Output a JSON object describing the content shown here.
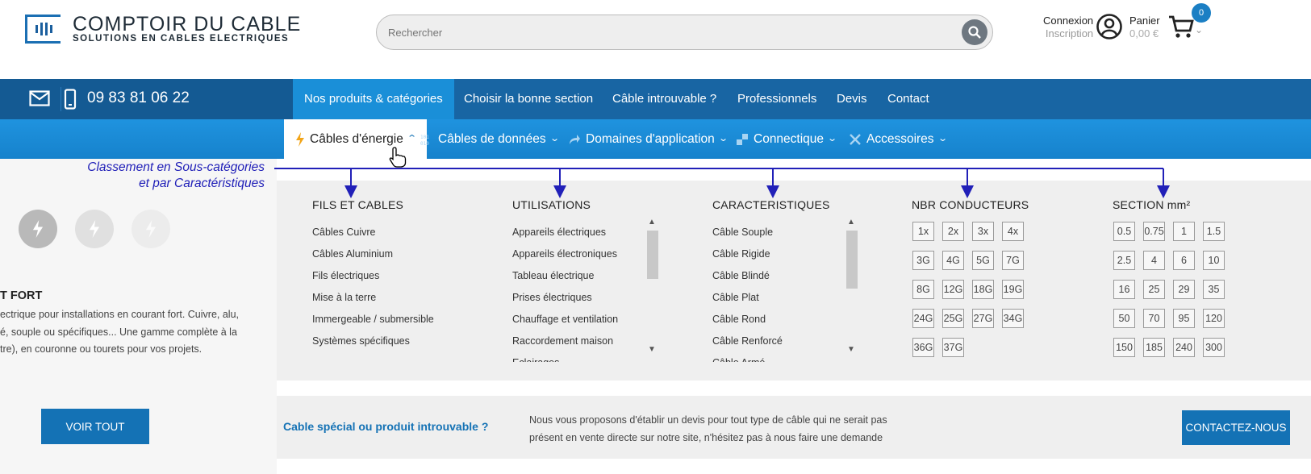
{
  "header": {
    "logo_title": "COMPTOIR DU CABLE",
    "logo_subtitle": "SOLUTIONS EN CABLES ELECTRIQUES",
    "search_placeholder": "Rechercher",
    "login": "Connexion",
    "signup": "Inscription",
    "cart_label": "Panier",
    "cart_amount": "0,00 €",
    "cart_count": "0"
  },
  "topnav": {
    "phone": "09 83 81 06 22",
    "items": [
      "Nos produits & catégories",
      "Choisir la bonne section",
      "Câble introuvable ?",
      "Professionnels",
      "Devis",
      "Contact"
    ]
  },
  "subnav": {
    "items": [
      "Câbles d'énergie",
      "Câbles de données",
      "Domaines d'application",
      "Connectique",
      "Accessoires"
    ]
  },
  "annotation": {
    "line1": "Classement en Sous-catégories",
    "line2": "et par Caractéristiques"
  },
  "left_panel": {
    "title": "T FORT",
    "desc_lines": [
      "ectrique pour installations en courant fort. Cuivre, alu,",
      "é, souple ou spécifiques... Une gamme complète à la",
      "tre), en couronne ou tourets pour vos projets."
    ],
    "button": "VOIR TOUT"
  },
  "menu": {
    "fils": {
      "title": "FILS ET CABLES",
      "items": [
        "Câbles Cuivre",
        "Câbles Aluminium",
        "Fils électriques",
        "Mise à la terre",
        "Immergeable / submersible",
        "Systèmes spécifiques"
      ]
    },
    "utilisations": {
      "title": "UTILISATIONS",
      "items": [
        "Appareils électriques",
        "Appareils électroniques",
        "Tableau électrique",
        "Prises électriques",
        "Chauffage et ventilation",
        "Raccordement maison",
        "Eclairages"
      ]
    },
    "caracteristiques": {
      "title": "CARACTERISTIQUES",
      "items": [
        "Câble Souple",
        "Câble Rigide",
        "Câble Blindé",
        "Câble Plat",
        "Câble Rond",
        "Câble Renforcé",
        "Câble Armé"
      ]
    },
    "conducteurs": {
      "title": "NBR CONDUCTEURS",
      "chips": [
        "1x",
        "2x",
        "3x",
        "4x",
        "3G",
        "4G",
        "5G",
        "7G",
        "8G",
        "12G",
        "18G",
        "19G",
        "24G",
        "25G",
        "27G",
        "34G",
        "36G",
        "37G"
      ]
    },
    "section": {
      "title": "SECTION mm²",
      "chips": [
        "0.5",
        "0.75",
        "1",
        "1.5",
        "2.5",
        "4",
        "6",
        "10",
        "16",
        "25",
        "29",
        "35",
        "50",
        "70",
        "95",
        "120",
        "150",
        "185",
        "240",
        "300"
      ]
    }
  },
  "bottom": {
    "title": "Cable spécial ou produit introuvable ?",
    "text": "Nous vous proposons d'établir un devis pour tout type de câble qui ne serait pas présent en vente directe sur notre site, n'hésitez pas à nous faire une demande",
    "button": "CONTACTEZ-NOUS"
  },
  "colors": {
    "primary": "#1865a3",
    "accent": "#1a8fd8",
    "annotation": "#2120b8"
  }
}
